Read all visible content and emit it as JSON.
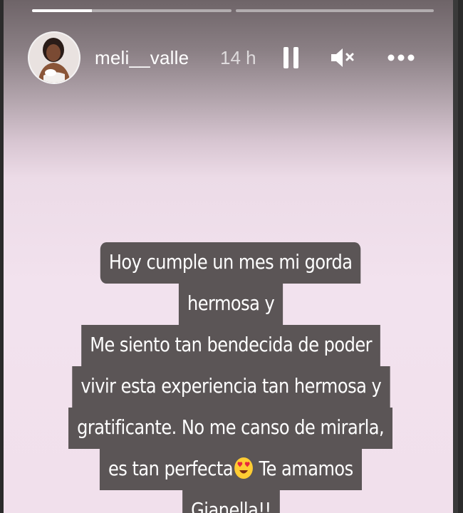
{
  "story": {
    "username": "meli__valle",
    "time_ago": "14 h",
    "progress": [
      {
        "segment": 1,
        "fill_fraction": 0.3
      },
      {
        "segment": 2,
        "fill_fraction": 0.0
      }
    ]
  },
  "icons": {
    "pause": "pause-icon",
    "mute": "mute-icon",
    "more": "more-icon",
    "emoji": "heart-eyes-emoji"
  },
  "caption": {
    "lines": [
      "Hoy cumple un mes mi gorda",
      "hermosa y",
      "Me siento tan bendecida de poder",
      "vivir esta experiencia tan hermosa y",
      "gratificante. No me canso de mirarla,",
      "es tan perfecta",
      "Te amamos",
      "Gianella!!"
    ]
  },
  "colors": {
    "caption_bg": "#5b5556",
    "caption_text": "#ffffff",
    "story_bg": "#f1e0ec"
  }
}
